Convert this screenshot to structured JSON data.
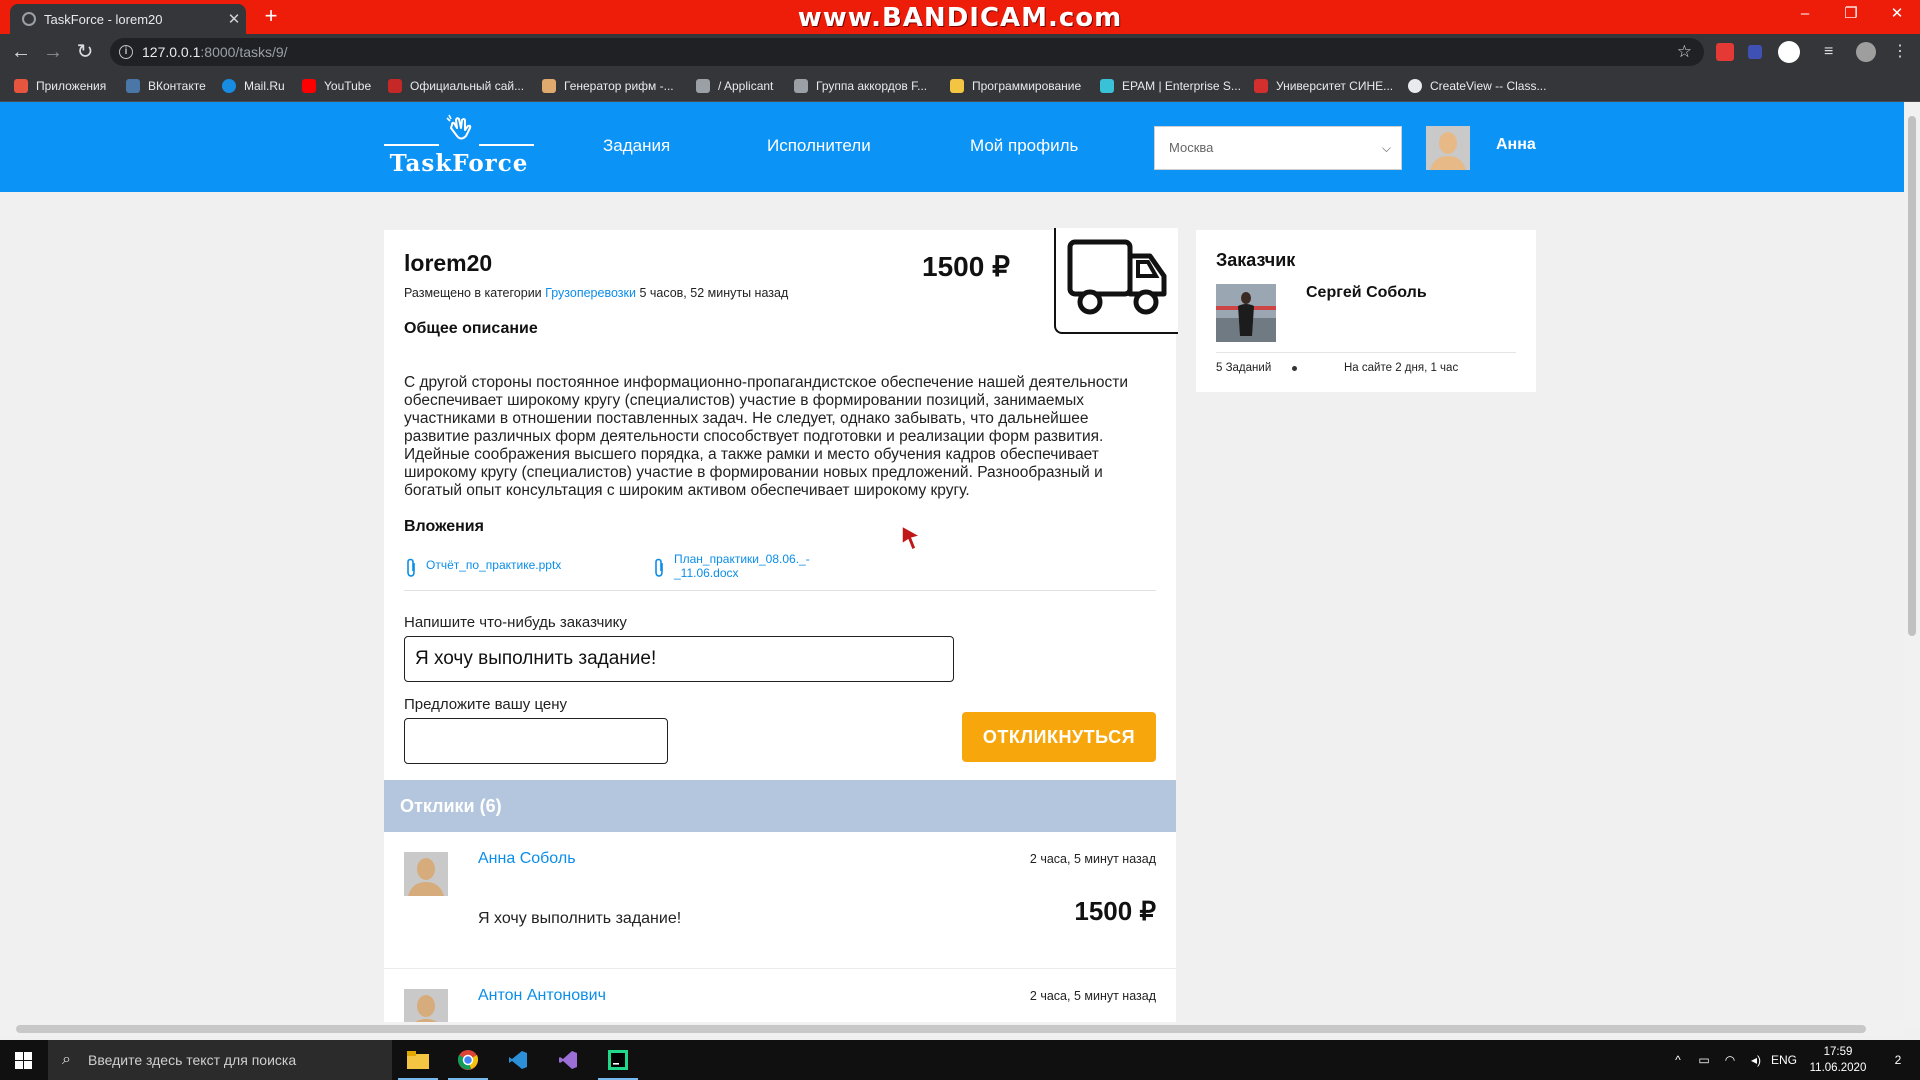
{
  "browser": {
    "tab_title": "TaskForce - lorem20",
    "watermark": "www.BANDICAM.com",
    "url_host": "127.0.0.1",
    "url_path": ":8000/tasks/9/",
    "bookmarks": [
      {
        "label": "Приложения",
        "color": "#e8553f"
      },
      {
        "label": "ВКонтакте",
        "color": "#4a76a8"
      },
      {
        "label": "Mail.Ru",
        "color": "#168de2"
      },
      {
        "label": "YouTube",
        "color": "#ff0000"
      },
      {
        "label": "Официальный сай...",
        "color": "#c62828"
      },
      {
        "label": "Генератор рифм -...",
        "color": "#e0a96d"
      },
      {
        "label": "/ Applicant",
        "color": "#9aa0a6"
      },
      {
        "label": "Группа аккордов F...",
        "color": "#9aa0a6"
      },
      {
        "label": "Программирование",
        "color": "#f4c542"
      },
      {
        "label": "EPAM | Enterprise S...",
        "color": "#39c2d7"
      },
      {
        "label": "Университет СИНЕ...",
        "color": "#d32f2f"
      },
      {
        "label": "CreateView -- Class...",
        "color": "#e8eaed"
      }
    ]
  },
  "site": {
    "logo": "TaskForce",
    "nav": [
      "Задания",
      "Исполнители",
      "Мой профиль"
    ],
    "city": "Москва",
    "user_name": "Анна",
    "accent_color": "#0b93f6"
  },
  "task": {
    "title": "lorem20",
    "meta_prefix": "Размещено в категории",
    "category": "Грузоперевозки",
    "meta_time": "5 часов, 52 минуты назад",
    "price": "1500 ₽",
    "description_title": "Общее описание",
    "description_lines": [
      "С другой стороны постоянное информационно-пропагандистское обеспечение нашей деятельности",
      "обеспечивает широкому кругу (специалистов) участие в формировании позиций, занимаемых",
      "участниками в отношении поставленных задач. Не следует, однако забывать, что дальнейшее",
      "развитие различных форм деятельности способствует подготовки и реализации форм развития.",
      "Идейные соображения высшего порядка, а также рамки и место обучения кадров обеспечивает",
      "широкому кругу (специалистов) участие в формировании новых предложений. Разнообразный и",
      "богатый опыт консультация с широким активом обеспечивает широкому кругу."
    ],
    "attachments_title": "Вложения",
    "attachments": [
      {
        "line1": "Отчёт_по_практике.pptx",
        "line2": ""
      },
      {
        "line1": "План_практики_08.06._-",
        "line2": "_11.06.docx"
      }
    ],
    "message_label": "Напишите что-нибудь заказчику",
    "message_value": "Я хочу выполнить задание!",
    "price_label": "Предложите вашу цену",
    "price_value": "",
    "respond_button": "ОТКЛИКНУТЬСЯ"
  },
  "responses": {
    "title": "Отклики (6)",
    "items": [
      {
        "name": "Анна Соболь",
        "time": "2 часа, 5 минут назад",
        "text": "Я хочу выполнить задание!",
        "price": "1500 ₽"
      },
      {
        "name": "Антон Антонович",
        "time": "2 часа, 5 минут назад",
        "text": "",
        "price": ""
      }
    ]
  },
  "customer": {
    "title": "Заказчик",
    "name": "Сергей Соболь",
    "tasks_count": "5 Заданий",
    "on_site": "На сайте 2 дня, 1 час"
  },
  "taskbar": {
    "search_placeholder": "Введите здесь текст для поиска",
    "lang": "ENG",
    "time": "17:59",
    "date": "11.06.2020",
    "notifications": "2"
  }
}
